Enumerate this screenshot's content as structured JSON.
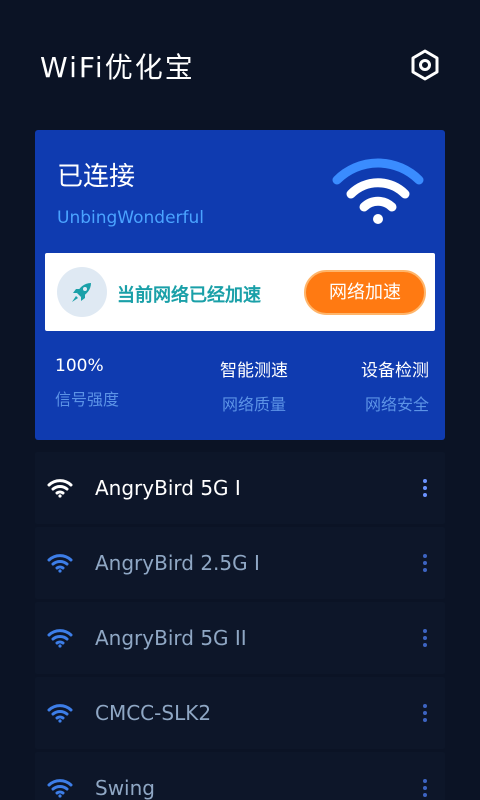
{
  "header": {
    "title": "WiFi优化宝",
    "settings_icon": "hexagon-settings-icon"
  },
  "card": {
    "status": "已连接",
    "ssid": "UnbingWonderful",
    "wifi_icon": "wifi-icon",
    "boost": {
      "icon": "rocket-icon",
      "message": "当前网络已经加速",
      "button_label": "网络加速"
    },
    "stats": [
      {
        "value": "100%",
        "label": "信号强度"
      },
      {
        "value": "智能测速",
        "label": "网络质量"
      },
      {
        "value": "设备检测",
        "label": "网络安全"
      }
    ]
  },
  "networks": [
    {
      "name": "AngryBird 5G I",
      "active": true
    },
    {
      "name": "AngryBird 2.5G I",
      "active": false
    },
    {
      "name": "AngryBird 5G II",
      "active": false
    },
    {
      "name": "CMCC-SLK2",
      "active": false
    },
    {
      "name": "Swing",
      "active": false
    }
  ],
  "colors": {
    "background": "#0b1325",
    "card": "#0f3bb0",
    "accent_orange": "#ff7a12",
    "ssid_blue": "#4aa3ff",
    "label_blue": "#5c93e6"
  }
}
